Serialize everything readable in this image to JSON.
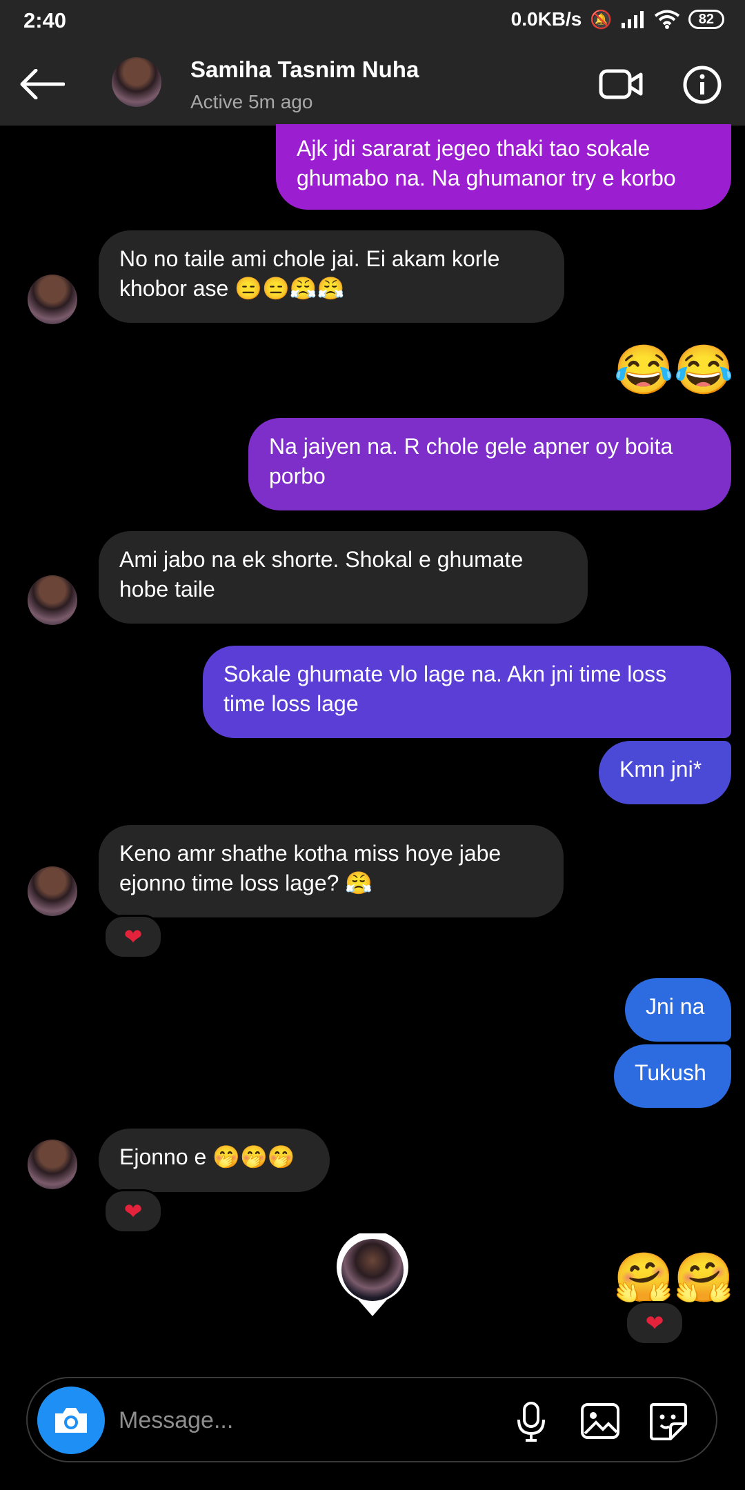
{
  "status_bar": {
    "time": "2:40",
    "network_speed": "0.0KB/s",
    "battery": "82"
  },
  "header": {
    "contact_name": "Samiha Tasnim Nuha",
    "contact_status": "Active 5m ago"
  },
  "messages": [
    {
      "side": "out",
      "text": "Ajk jdi sararat jegeo thaki tao sokale\nghumabo na. Na ghumanor try e korbo",
      "color": "#9b1fd0"
    },
    {
      "side": "in",
      "text": "No no taile ami chole jai. Ei akam korle\nkhobor ase 😑😑😤😤"
    },
    {
      "side": "out",
      "emoji": "😂😂"
    },
    {
      "side": "out",
      "text": "Na jaiyen na. R chole gele apner oy boita\nporbo",
      "color": "#7e2ec9"
    },
    {
      "side": "in",
      "text": "Ami jabo na ek shorte. Shokal e ghumate\nhobe taile"
    },
    {
      "side": "out",
      "text": "Sokale ghumate vlo lage na. Akn jni time loss\ntime loss lage",
      "color": "#5a3ed6"
    },
    {
      "side": "out",
      "text": "Kmn jni*",
      "color": "#4a4ad6"
    },
    {
      "side": "in",
      "text": "Keno amr shathe kotha miss hoye jabe\nejonno time loss lage? 😤",
      "reaction": "❤"
    },
    {
      "side": "out",
      "text": "Jni na",
      "color": "#2d6be0"
    },
    {
      "side": "out",
      "text": "Tukush",
      "color": "#2d6be0"
    },
    {
      "side": "in",
      "text": "Ejonno e 🤭🤭🤭",
      "reaction": "❤"
    },
    {
      "side": "out",
      "emoji": "🤗🤗",
      "reaction": "❤"
    }
  ],
  "composer": {
    "placeholder": "Message..."
  }
}
